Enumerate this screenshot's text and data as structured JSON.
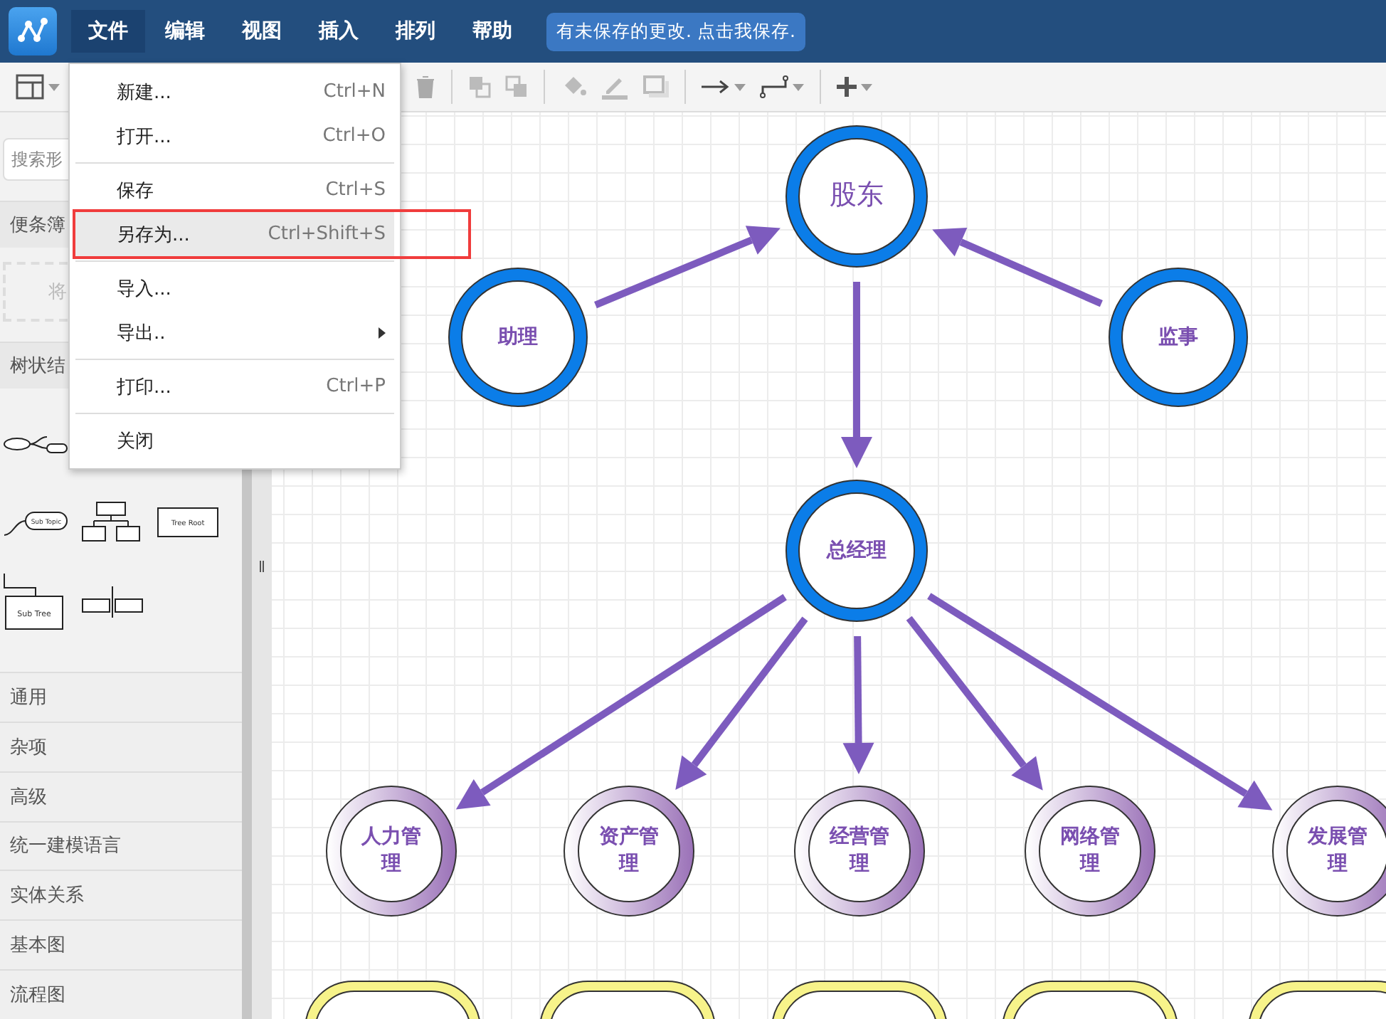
{
  "menubar": {
    "items": [
      {
        "label": "文件",
        "selected": true
      },
      {
        "label": "编辑",
        "selected": false
      },
      {
        "label": "视图",
        "selected": false
      },
      {
        "label": "插入",
        "selected": false
      },
      {
        "label": "排列",
        "selected": false
      },
      {
        "label": "帮助",
        "selected": false
      }
    ],
    "notice": "有未保存的更改. 点击我保存."
  },
  "file_menu": {
    "items": [
      {
        "kind": "item",
        "label": "新建...",
        "shortcut": "Ctrl+N",
        "selected": false,
        "annotated": false,
        "submenu": false
      },
      {
        "kind": "item",
        "label": "打开...",
        "shortcut": "Ctrl+O",
        "selected": false,
        "annotated": false,
        "submenu": false
      },
      {
        "kind": "separator"
      },
      {
        "kind": "item",
        "label": "保存",
        "shortcut": "Ctrl+S",
        "selected": false,
        "annotated": false,
        "submenu": false
      },
      {
        "kind": "item",
        "label": "另存为...",
        "shortcut": "Ctrl+Shift+S",
        "selected": true,
        "annotated": true,
        "submenu": false
      },
      {
        "kind": "separator"
      },
      {
        "kind": "item",
        "label": "导入...",
        "selected": false,
        "annotated": false,
        "submenu": false
      },
      {
        "kind": "item",
        "label": "导出..",
        "selected": false,
        "annotated": false,
        "submenu": true
      },
      {
        "kind": "separator"
      },
      {
        "kind": "item",
        "label": "打印...",
        "shortcut": "Ctrl+P",
        "selected": false,
        "annotated": false,
        "submenu": false
      },
      {
        "kind": "separator"
      },
      {
        "kind": "item",
        "label": "关闭",
        "selected": false,
        "annotated": false,
        "submenu": false
      }
    ]
  },
  "sidebar": {
    "search": {
      "placeholder": "搜索形"
    },
    "sections": [
      {
        "title": "便条簿",
        "kind": "scratchpad",
        "drop_hint": "将"
      },
      {
        "title": "树状结",
        "kind": "shapes",
        "shapes": [
          "Sub Topic",
          "Tree Root",
          "Sub Tree"
        ]
      }
    ],
    "categories": [
      "通用",
      "杂项",
      "高级",
      "统一建模语言",
      "实体关系",
      "基本图",
      "流程图"
    ]
  },
  "diagram": {
    "nodes": [
      {
        "label": "股东",
        "kind": "primary"
      },
      {
        "label": "助理",
        "kind": "primary"
      },
      {
        "label": "监事",
        "kind": "primary"
      },
      {
        "label": "总经理",
        "kind": "primary"
      },
      {
        "label": "人力管理",
        "kind": "secondary"
      },
      {
        "label": "资产管理",
        "kind": "secondary"
      },
      {
        "label": "经营管理",
        "kind": "secondary"
      },
      {
        "label": "网络管理",
        "kind": "secondary"
      },
      {
        "label": "发展管理",
        "kind": "secondary"
      },
      {
        "kind": "terminal"
      },
      {
        "kind": "terminal"
      },
      {
        "kind": "terminal"
      },
      {
        "kind": "terminal"
      },
      {
        "kind": "terminal"
      }
    ]
  }
}
